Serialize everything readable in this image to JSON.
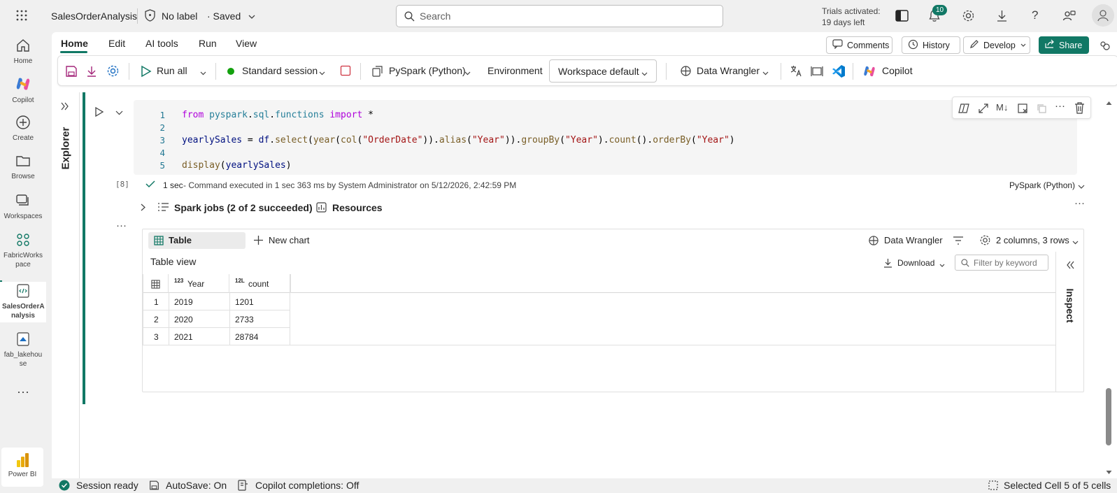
{
  "header": {
    "app_title": "SalesOrderAnalysis",
    "label": "No label",
    "saved": "· Saved",
    "search_placeholder": "Search",
    "trials_line1": "Trials activated:",
    "trials_line2": "19 days left",
    "notification_count": "10"
  },
  "rail": {
    "items": [
      {
        "label": "Home"
      },
      {
        "label": "Copilot"
      },
      {
        "label": "Create"
      },
      {
        "label": "Browse"
      },
      {
        "label": "Workspaces"
      },
      {
        "label": "FabricWorks pace"
      },
      {
        "label": "SalesOrderA nalysis"
      },
      {
        "label": "fab_lakehou se"
      },
      {
        "label": "Power BI"
      }
    ]
  },
  "tabs": [
    "Home",
    "Edit",
    "AI tools",
    "Run",
    "View"
  ],
  "top_actions": {
    "comments": "Comments",
    "history": "History",
    "develop": "Develop",
    "share": "Share"
  },
  "ribbon": {
    "run_all": "Run all",
    "session": "Standard session",
    "language": "PySpark (Python)",
    "environment_label": "Environment",
    "environment_value": "Workspace default",
    "data_wrangler": "Data Wrangler",
    "copilot": "Copilot"
  },
  "explorer_label": "Explorer",
  "cell": {
    "exec_count": "[8]",
    "line_numbers": [
      "1",
      "2",
      "3",
      "4",
      "5"
    ],
    "status_time": "1 sec",
    "status_text": "- Command executed in 1 sec 363 ms by System Administrator on 5/12/2026, 2:42:59 PM",
    "language": "PySpark (Python)",
    "spark_jobs": "Spark jobs (2 of 2 succeeded)",
    "resources": "Resources"
  },
  "output": {
    "tab_table": "Table",
    "new_chart": "New chart",
    "data_wrangler": "Data Wrangler",
    "columns_rows": "2 columns, 3 rows",
    "table_view": "Table view",
    "download": "Download",
    "filter_placeholder": "Filter by keyword",
    "inspect": "Inspect",
    "columns": [
      {
        "type_badge": "123",
        "name": "Year"
      },
      {
        "type_badge": "12L",
        "name": "count"
      }
    ],
    "rows": [
      {
        "idx": "1",
        "year": "2019",
        "count": "1201"
      },
      {
        "idx": "2",
        "year": "2020",
        "count": "2733"
      },
      {
        "idx": "3",
        "year": "2021",
        "count": "28784"
      }
    ]
  },
  "statusbar": {
    "session": "Session ready",
    "autosave": "AutoSave: On",
    "copilot_completions": "Copilot completions: Off",
    "selected_cell": "Selected Cell 5 of 5 cells"
  },
  "colors": {
    "accent_green": "#117865",
    "selected_bar": "#117865",
    "notification_badge": "#117865"
  }
}
